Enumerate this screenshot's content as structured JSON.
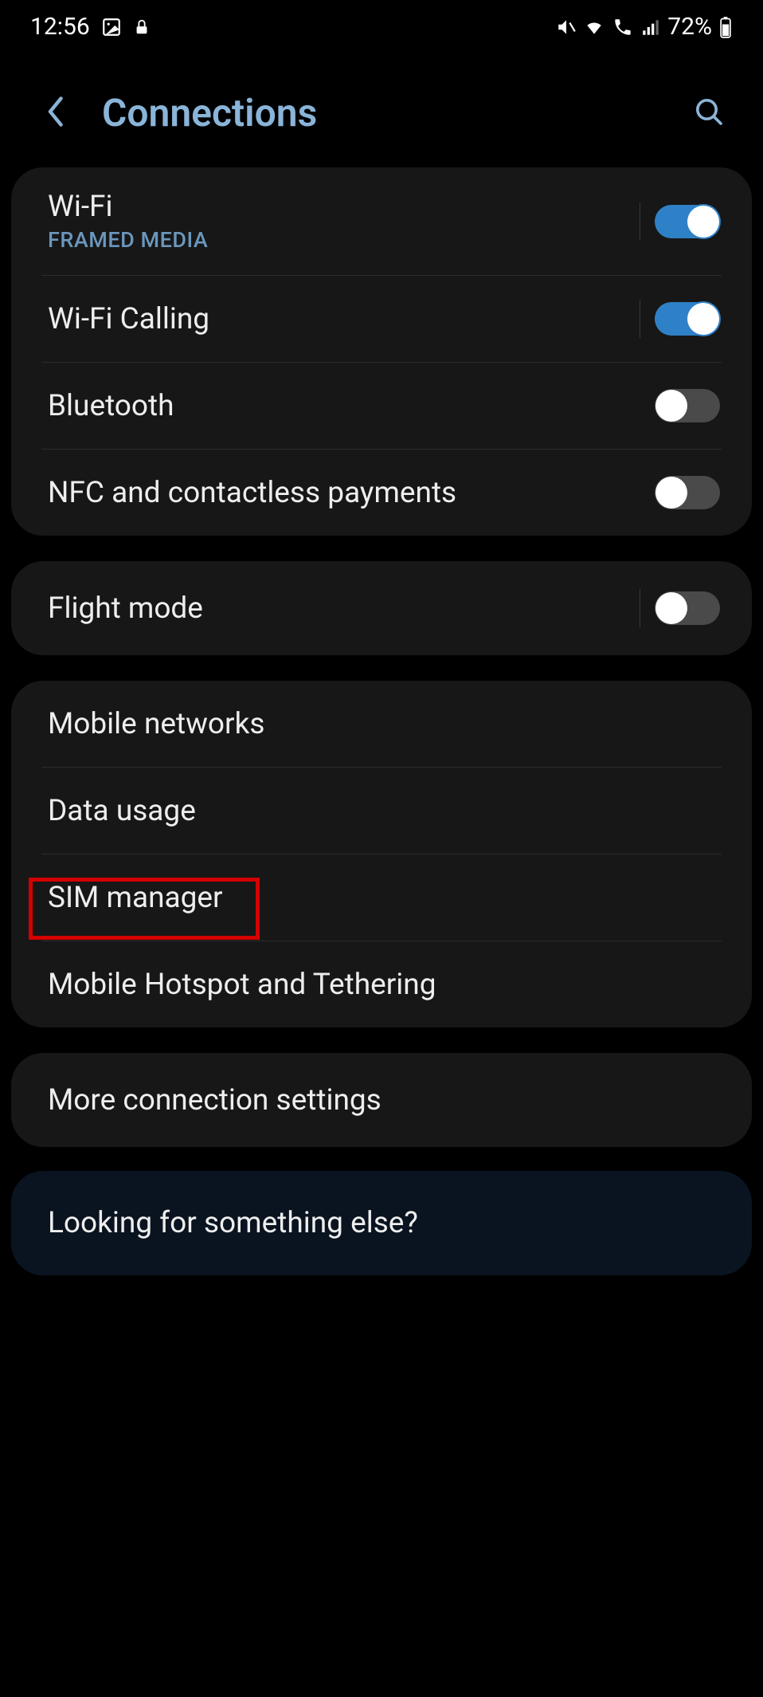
{
  "status": {
    "time": "12:56",
    "battery": "72%"
  },
  "header": {
    "title": "Connections"
  },
  "groups": [
    {
      "items": [
        {
          "title": "Wi-Fi",
          "subtitle": "FRAMED MEDIA",
          "toggle": true,
          "hasToggle": true,
          "hasDivider": true
        },
        {
          "title": "Wi-Fi Calling",
          "toggle": true,
          "hasToggle": true,
          "hasDivider": true
        },
        {
          "title": "Bluetooth",
          "toggle": false,
          "hasToggle": true
        },
        {
          "title": "NFC and contactless payments",
          "toggle": false,
          "hasToggle": true
        }
      ]
    },
    {
      "items": [
        {
          "title": "Flight mode",
          "toggle": false,
          "hasToggle": true,
          "hasDivider": true
        }
      ]
    },
    {
      "items": [
        {
          "title": "Mobile networks",
          "hasToggle": false
        },
        {
          "title": "Data usage",
          "hasToggle": false
        },
        {
          "title": "SIM manager",
          "hasToggle": false,
          "highlight": true
        },
        {
          "title": "Mobile Hotspot and Tethering",
          "hasToggle": false
        }
      ]
    },
    {
      "items": [
        {
          "title": "More connection settings",
          "hasToggle": false
        }
      ]
    }
  ],
  "footer": {
    "title": "Looking for something else?"
  }
}
